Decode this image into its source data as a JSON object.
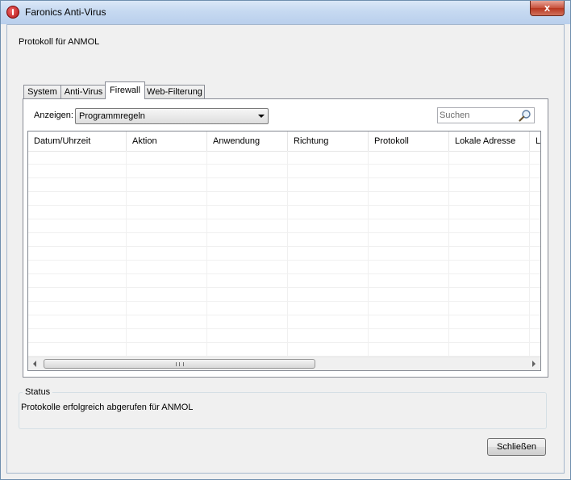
{
  "window": {
    "title": "Faronics Anti-Virus",
    "close_glyph": "x"
  },
  "heading": "Protokoll für ANMOL",
  "tabs": [
    {
      "label": "System"
    },
    {
      "label": "Anti-Virus"
    },
    {
      "label": "Firewall",
      "active": true
    },
    {
      "label": "Web-Filterung"
    }
  ],
  "filter": {
    "label": "Anzeigen:",
    "selected": "Programmregeln"
  },
  "search": {
    "placeholder": "Suchen"
  },
  "table": {
    "columns": [
      "Datum/Uhrzeit",
      "Aktion",
      "Anwendung",
      "Richtung",
      "Protokoll",
      "Lokale Adresse",
      "L"
    ],
    "rows": []
  },
  "scrollbar": {
    "grip_glyph": "III"
  },
  "status": {
    "legend": "Status",
    "text": "Protokolle erfolgreich abgerufen für ANMOL"
  },
  "buttons": {
    "close_label": "Schließen"
  },
  "colors": {
    "title_bar": "#c6d9f1",
    "close_button": "#c7513c",
    "window_background": "#f0f0f0"
  }
}
